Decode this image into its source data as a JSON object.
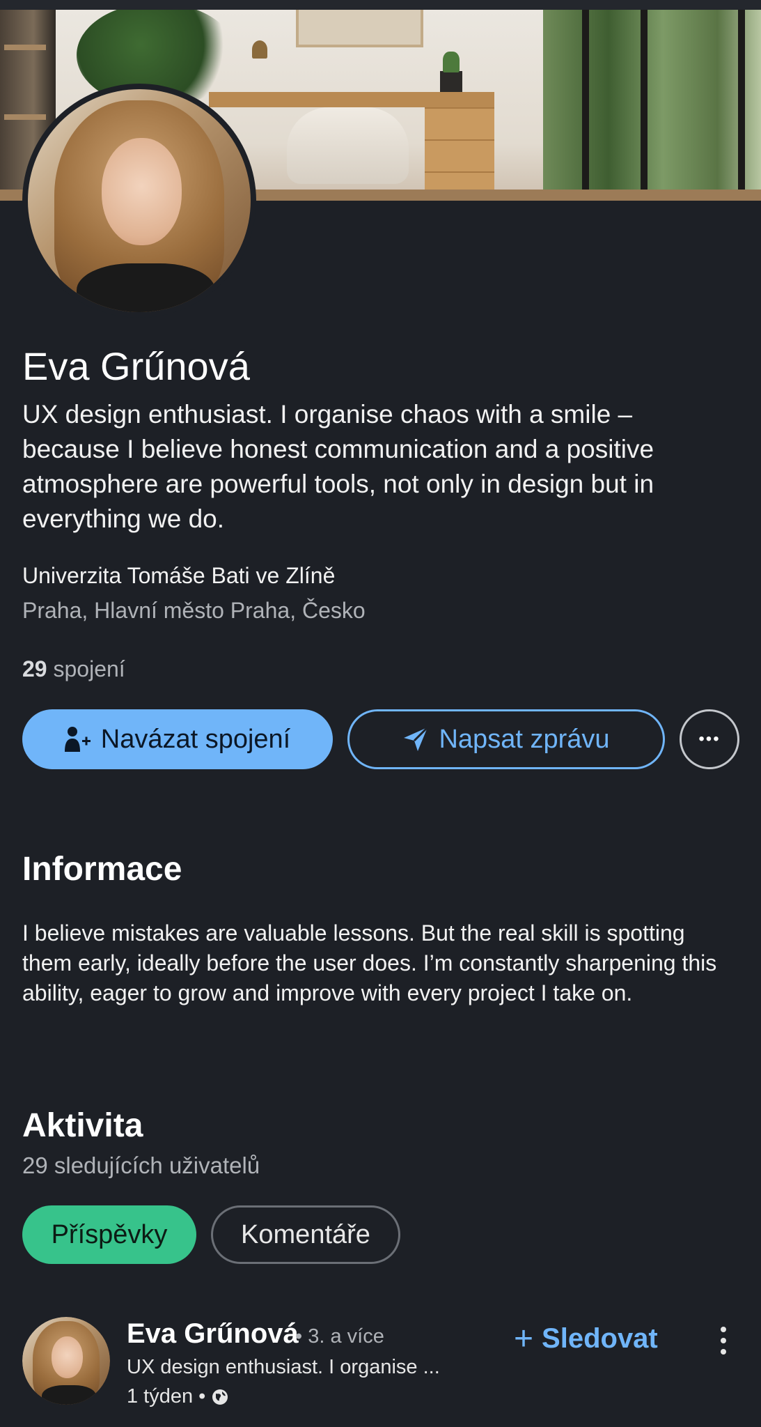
{
  "profile": {
    "name": "Eva Grűnová",
    "headline": "UX design enthusiast. I organise chaos with a smile – because I believe honest communication and a positive atmosphere are powerful tools, not only in design but in everything we do.",
    "school": "Univerzita Tomáše Bati ve Zlíně",
    "location": "Praha, Hlavní město Praha, Česko",
    "connections_count": "29",
    "connections_label": "spojení"
  },
  "actions": {
    "connect_label": "Navázat spojení",
    "message_label": "Napsat zprávu",
    "more_label": "•••",
    "connect_icon": "add-person-icon",
    "message_icon": "send-icon",
    "more_icon": "more-horizontal-icon"
  },
  "about": {
    "title": "Informace",
    "text": "I believe mistakes are valuable lessons. But the real skill is spotting them early, ideally before the user does. I’m constantly sharpening this ability, eager to grow and improve with every project I take on."
  },
  "activity": {
    "title": "Aktivita",
    "followers": "29 sledujících uživatelů",
    "tabs": [
      {
        "label": "Příspěvky",
        "active": true
      },
      {
        "label": "Komentáře",
        "active": false
      }
    ]
  },
  "post": {
    "author": "Eva Grűnová",
    "degree": "• 3. a více",
    "headline": "UX design enthusiast. I organise ...",
    "time": "1 týden •",
    "visibility_icon": "globe-icon",
    "follow_label": "Sledovat",
    "follow_icon": "plus-icon",
    "menu_icon": "more-vertical-icon"
  },
  "colors": {
    "background": "#1d2026",
    "accent_blue": "#70b5f9",
    "accent_green": "#37c38b",
    "muted_text": "#b0b3b8"
  }
}
